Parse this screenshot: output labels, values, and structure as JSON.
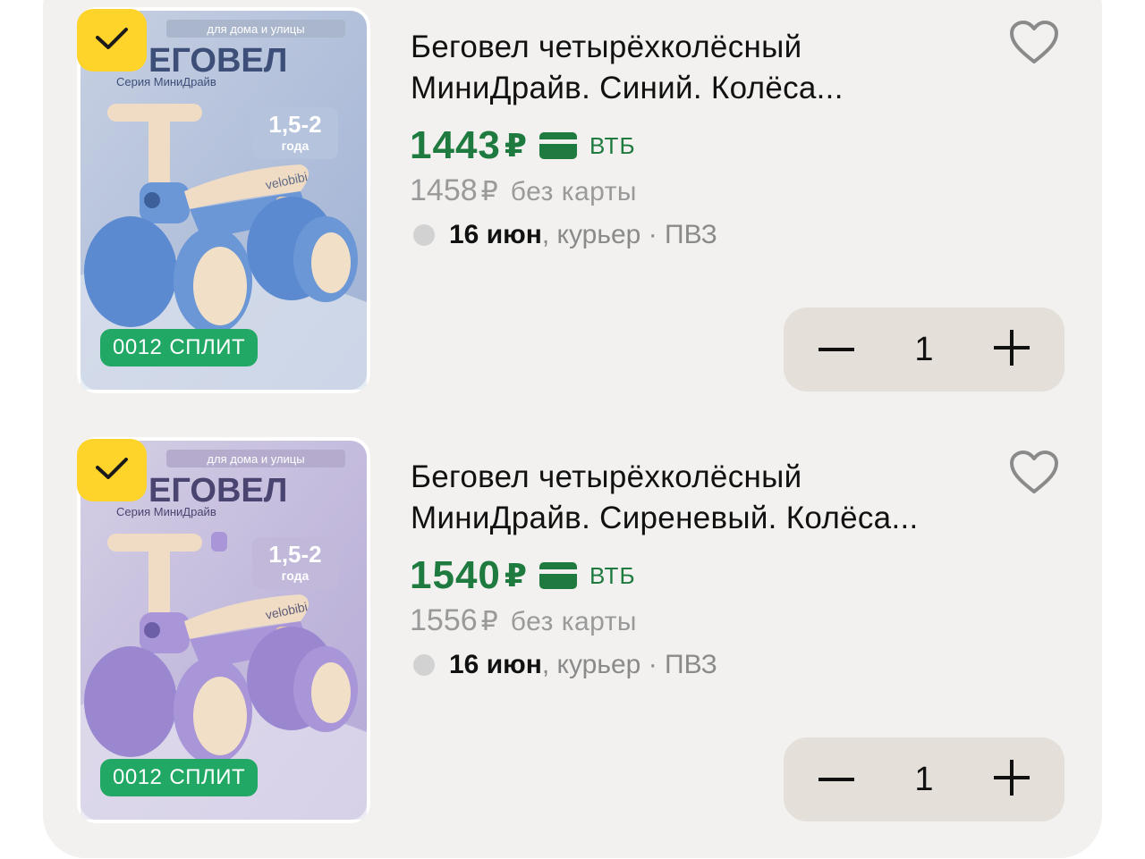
{
  "items": [
    {
      "image": {
        "banner_top": "для дома и улицы",
        "brand_word": "ЕГОВЕЛ",
        "series": "Серия МиниДрайв",
        "age": "1,5-2",
        "age_unit": "года",
        "logo": "velobibi",
        "color_hex": "#6b97d6",
        "bg_hex": "#b7c4de"
      },
      "selected": true,
      "split_badge": {
        "num": "0012",
        "label": "СПЛИТ"
      },
      "title_line1": "Беговел четырёхколёсный",
      "title_line2": "МиниДрайв. Синий. Колёса...",
      "price": "1443",
      "currency": "₽",
      "bank": "ВТБ",
      "old_price": "1458",
      "old_currency": "₽",
      "without_card": "без карты",
      "delivery_date": "16 июн",
      "delivery_method": ", курьер · ПВЗ",
      "quantity": "1"
    },
    {
      "image": {
        "banner_top": "для дома и улицы",
        "brand_word": "ЕГОВЕЛ",
        "series": "Серия МиниДрайв",
        "age": "1,5-2",
        "age_unit": "года",
        "logo": "velobibi",
        "color_hex": "#a896d8",
        "bg_hex": "#c9bfe0"
      },
      "selected": true,
      "split_badge": {
        "num": "0012",
        "label": "СПЛИТ"
      },
      "title_line1": "Беговел четырёхколёсный",
      "title_line2": "МиниДрайв. Сиреневый. Колёса...",
      "price": "1540",
      "currency": "₽",
      "bank": "ВТБ",
      "old_price": "1556",
      "old_currency": "₽",
      "without_card": "без карты",
      "delivery_date": "16 июн",
      "delivery_method": ", курьер · ПВЗ",
      "quantity": "1"
    }
  ],
  "icons": {
    "check": "checkmark-icon",
    "favorite": "heart-outline-icon",
    "card": "bank-card-icon",
    "minus": "minus-icon",
    "plus": "plus-icon"
  },
  "colors": {
    "price_green": "#1e7a3f",
    "split_green": "#21a865",
    "check_yellow": "#fed42b",
    "stepper_bg": "#e4e0d9",
    "panel_bg": "#f2f1ef"
  }
}
